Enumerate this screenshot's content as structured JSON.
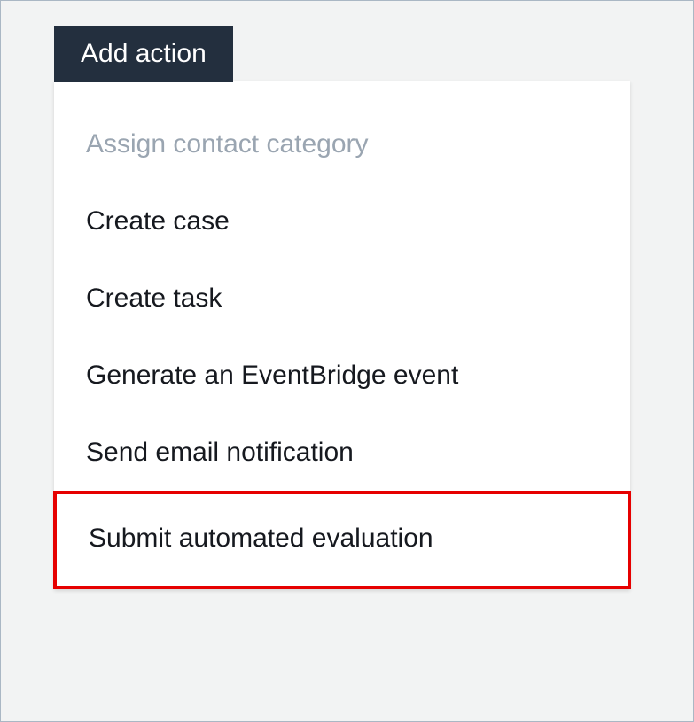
{
  "button": {
    "label": "Add action"
  },
  "menu": {
    "items": [
      {
        "label": "Assign contact category",
        "disabled": true,
        "highlighted": false
      },
      {
        "label": "Create case",
        "disabled": false,
        "highlighted": false
      },
      {
        "label": "Create task",
        "disabled": false,
        "highlighted": false
      },
      {
        "label": "Generate an EventBridge event",
        "disabled": false,
        "highlighted": false
      },
      {
        "label": "Send email notification",
        "disabled": false,
        "highlighted": false
      },
      {
        "label": "Submit automated evaluation",
        "disabled": false,
        "highlighted": true
      }
    ]
  }
}
